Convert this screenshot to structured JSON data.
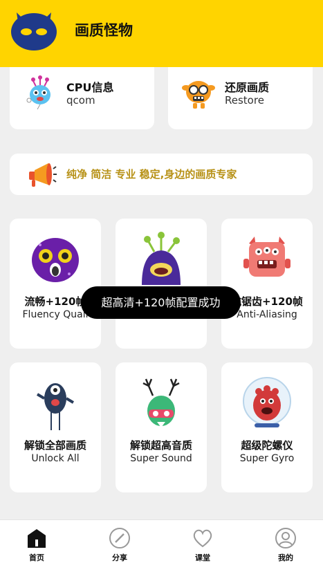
{
  "app": {
    "title": "画质怪物",
    "brand_color": "#ffd400"
  },
  "info_cards": [
    {
      "title": "CPU信息",
      "subtitle": "qcom",
      "icon": "balloon-monster-icon"
    },
    {
      "title": "还原画质",
      "subtitle": "Restore",
      "icon": "glasses-monster-icon"
    }
  ],
  "slogan": {
    "text": "纯净 简洁 专业 稳定,身边的画质专家",
    "icon": "megaphone-icon",
    "color": "#b79116"
  },
  "features": [
    {
      "cn": "流畅+120帧",
      "en": "Fluency Quali",
      "icon": "purple-round-monster-icon"
    },
    {
      "cn": "",
      "en": "",
      "icon": "purple-antenna-monster-icon"
    },
    {
      "cn": "抗锯齿+120帧",
      "en": "Anti-Aliasing",
      "icon": "red-robot-monster-icon"
    },
    {
      "cn": "解锁全部画质",
      "en": "Unlock All",
      "icon": "cyclops-monster-icon"
    },
    {
      "cn": "解锁超高音质",
      "en": "Super Sound",
      "icon": "antler-monster-icon"
    },
    {
      "cn": "超级陀螺仪",
      "en": "Super Gyro",
      "icon": "bubble-monster-icon"
    }
  ],
  "toast": {
    "text": "超高清+120帧配置成功"
  },
  "tabbar": [
    {
      "label": "首页",
      "icon": "home-icon",
      "active": true
    },
    {
      "label": "分享",
      "icon": "compass-icon"
    },
    {
      "label": "课堂",
      "icon": "heart-icon"
    },
    {
      "label": "我的",
      "icon": "profile-icon"
    }
  ]
}
